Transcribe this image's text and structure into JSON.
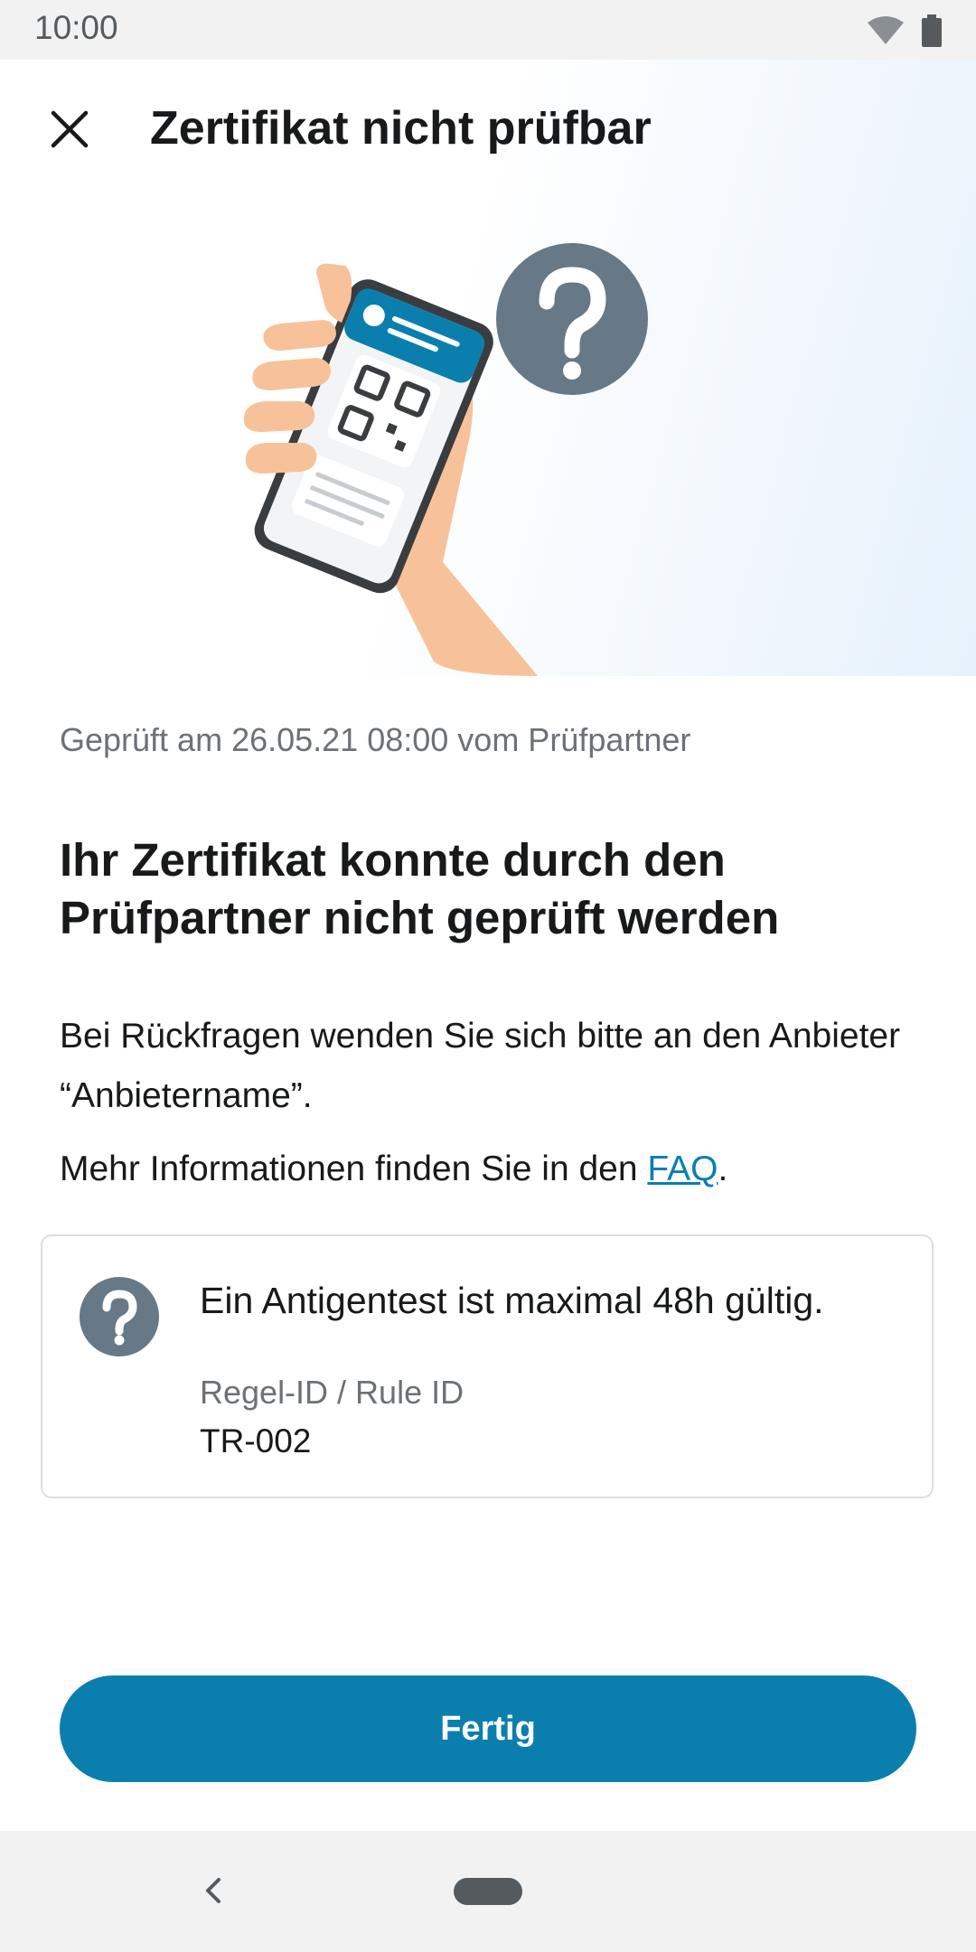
{
  "status_bar": {
    "time": "10:00",
    "icons": [
      "wifi-icon",
      "battery-icon"
    ]
  },
  "toolbar": {
    "close_icon": "close-icon",
    "title": "Zertifikat nicht prüfbar"
  },
  "illustration": {
    "description_icon": "question-icon"
  },
  "content": {
    "checked_line": "Geprüft am 26.05.21 08:00 vom Prüfpartner",
    "headline": "Ihr Zertifikat konnte durch den Prüfpartner nicht geprüft werden",
    "body": "Bei Rückfragen wenden Sie sich bitte an den Anbieter “Anbietername”.",
    "more_info_prefix": "Mehr Informationen finden Sie in den ",
    "faq_link": "FAQ",
    "more_info_suffix": "."
  },
  "rule_card": {
    "icon": "question-icon",
    "text": "Ein Antigentest ist maximal 48h gültig.",
    "label": "Regel-ID / Rule ID",
    "rule_id": "TR-002"
  },
  "done_button": {
    "label": "Fertig"
  },
  "nav_bar": {
    "back_icon": "back-icon",
    "home_icon": "home-pill-icon"
  },
  "colors": {
    "primary": "#0a7fae",
    "icon_gray": "#677887",
    "link": "#0a7fb3",
    "text": "#17191a",
    "secondary_text": "#6c7177"
  }
}
